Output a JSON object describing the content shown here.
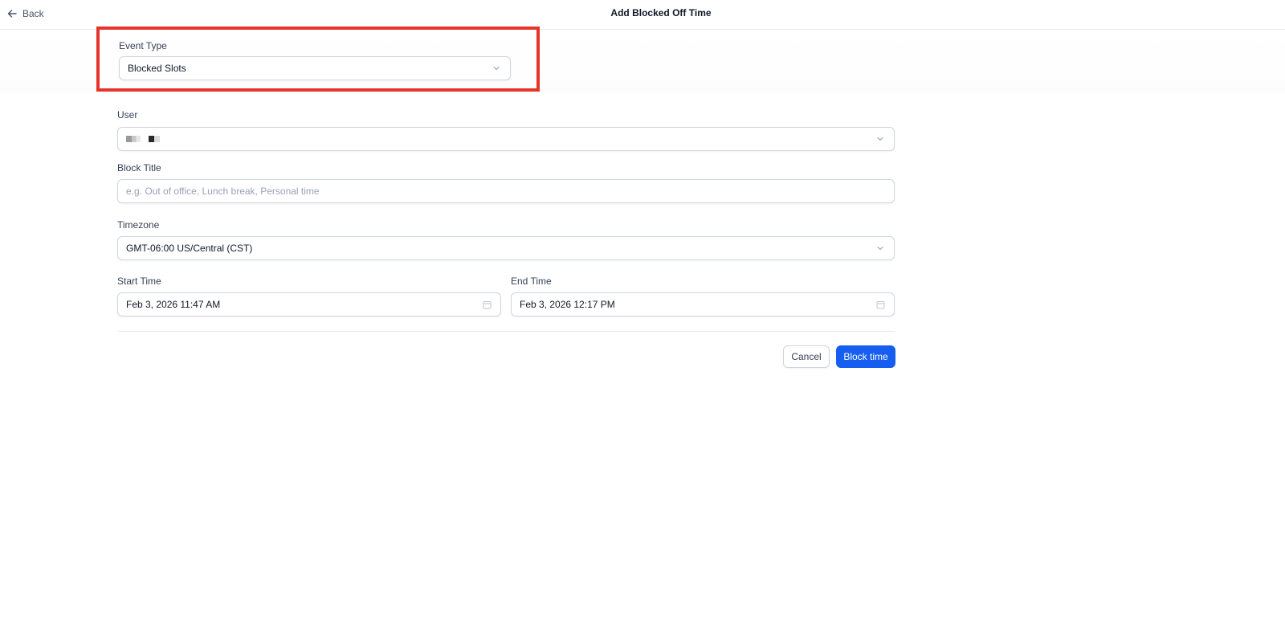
{
  "header": {
    "back_label": "Back",
    "title": "Add Blocked Off Time"
  },
  "event_type": {
    "label": "Event Type",
    "value": "Blocked Slots"
  },
  "user": {
    "label": "User"
  },
  "block_title": {
    "label": "Block Title",
    "placeholder": "e.g. Out of office, Lunch break, Personal time"
  },
  "timezone": {
    "label": "Timezone",
    "value": "GMT-06:00 US/Central (CST)"
  },
  "start_time": {
    "label": "Start Time",
    "value": "Feb 3, 2026 11:47 AM"
  },
  "end_time": {
    "label": "End Time",
    "value": "Feb 3, 2026 12:17 PM"
  },
  "actions": {
    "cancel_label": "Cancel",
    "submit_label": "Block time"
  },
  "colors": {
    "primary": "#155eef",
    "highlight": "#e53429",
    "border": "#d0d5dd"
  },
  "icons": {
    "back": "arrow-left-icon",
    "dropdown": "chevron-down-icon",
    "date": "calendar-icon"
  }
}
